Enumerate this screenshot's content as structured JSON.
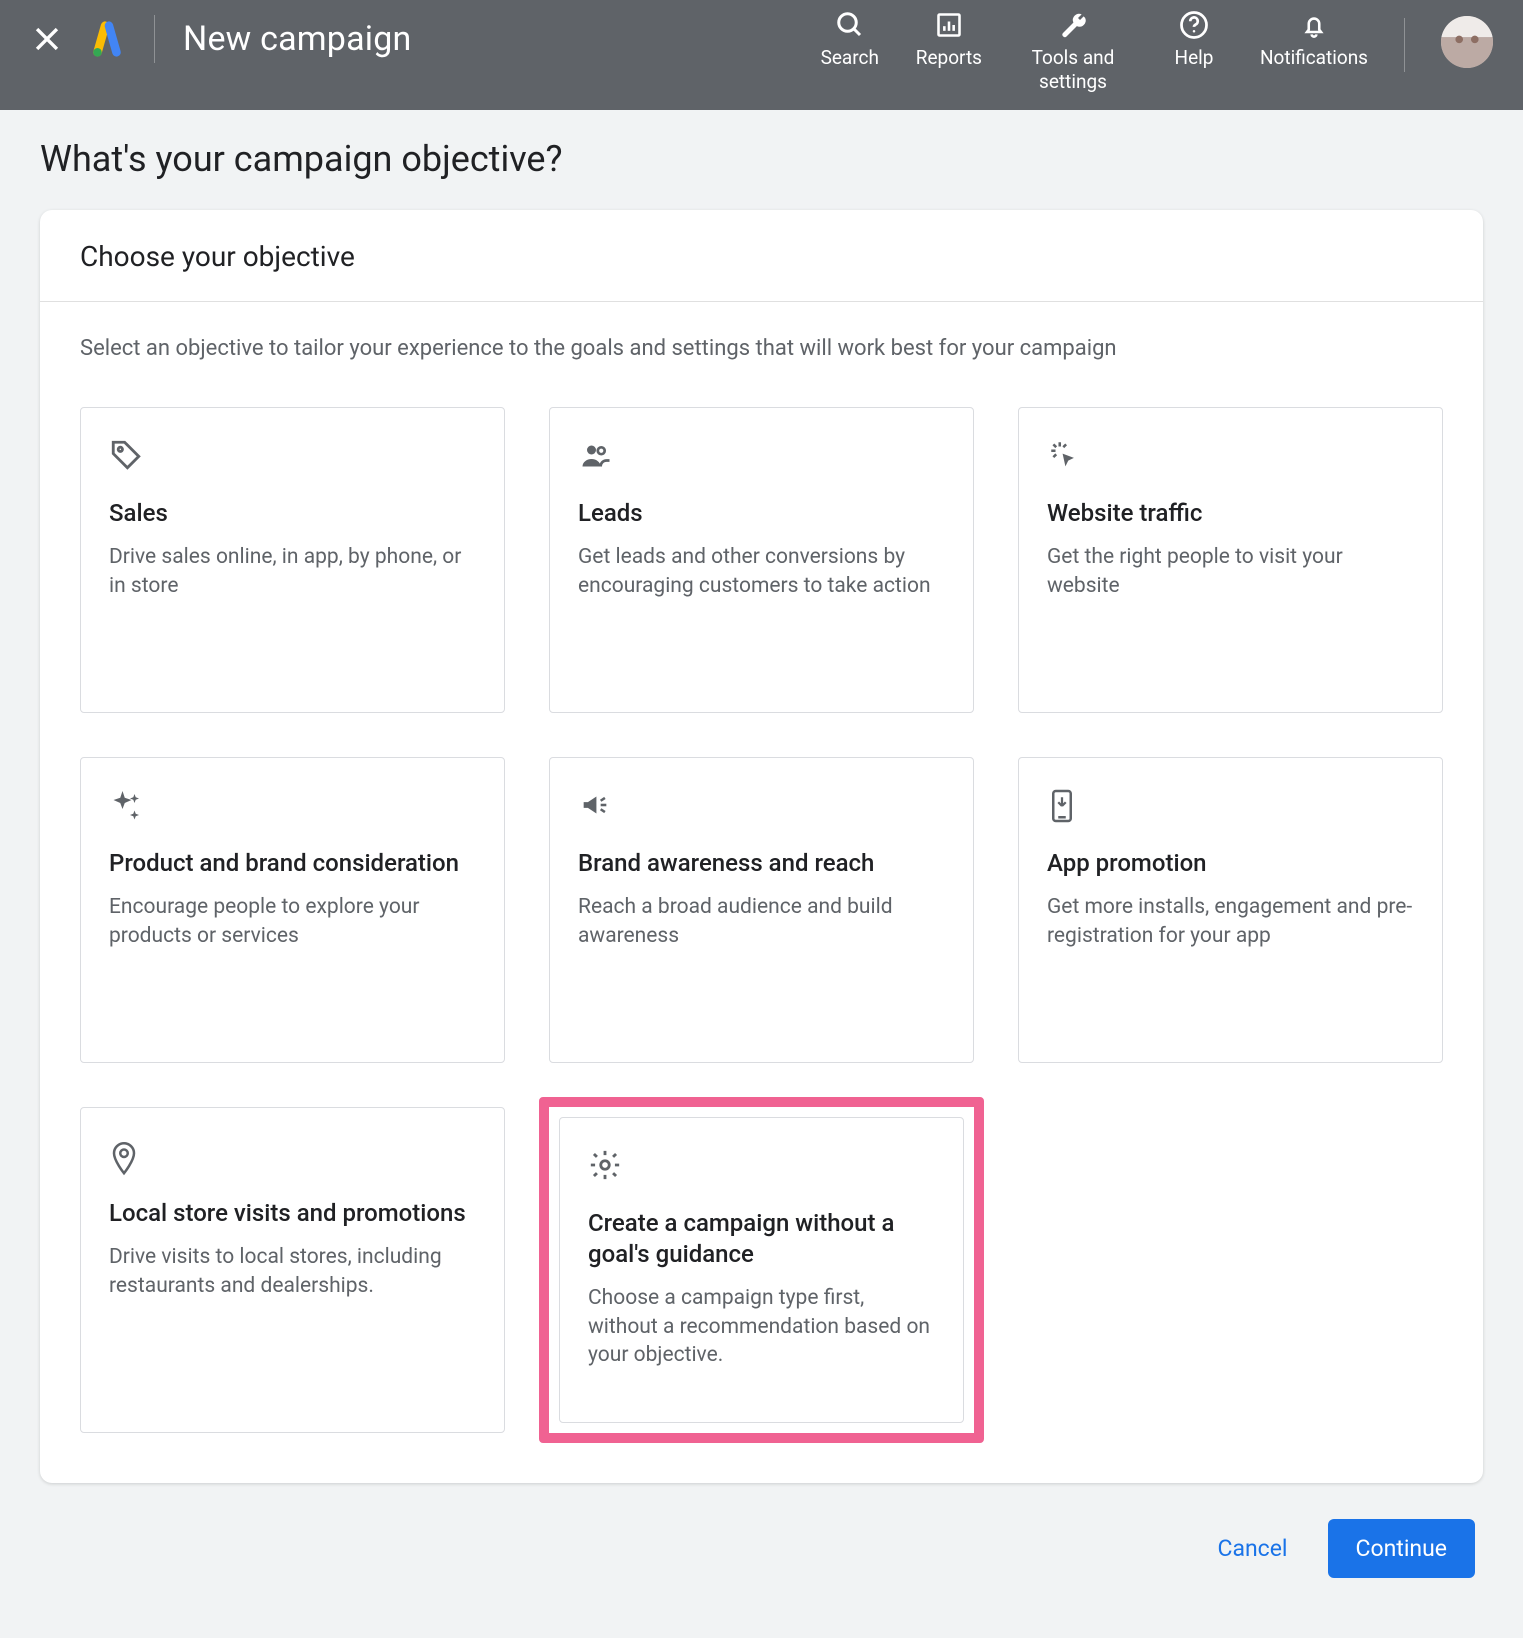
{
  "header": {
    "title": "New campaign",
    "nav": {
      "search": "Search",
      "reports": "Reports",
      "tools": "Tools and settings",
      "help": "Help",
      "notifications": "Notifications"
    }
  },
  "page": {
    "question": "What's your campaign objective?",
    "card_title": "Choose your objective",
    "card_subtitle": "Select an objective to tailor your experience to the goals and settings that will work best for your campaign"
  },
  "objectives": {
    "sales": {
      "title": "Sales",
      "desc": "Drive sales online, in app, by phone, or in store"
    },
    "leads": {
      "title": "Leads",
      "desc": "Get leads and other conversions by encouraging customers to take action"
    },
    "traffic": {
      "title": "Website traffic",
      "desc": "Get the right people to visit your website"
    },
    "product": {
      "title": "Product and brand consideration",
      "desc": "Encourage people to explore your products or services"
    },
    "brand": {
      "title": "Brand awareness and reach",
      "desc": "Reach a broad audience and build awareness"
    },
    "app": {
      "title": "App promotion",
      "desc": "Get more installs, engagement and pre-registration for your app"
    },
    "local": {
      "title": "Local store visits and promotions",
      "desc": "Drive visits to local stores, including restaurants and dealerships."
    },
    "nogoal": {
      "title": "Create a campaign without a goal's guidance",
      "desc": "Choose a campaign type first, without a recommendation based on your objective."
    }
  },
  "footer": {
    "cancel": "Cancel",
    "continue": "Continue"
  }
}
